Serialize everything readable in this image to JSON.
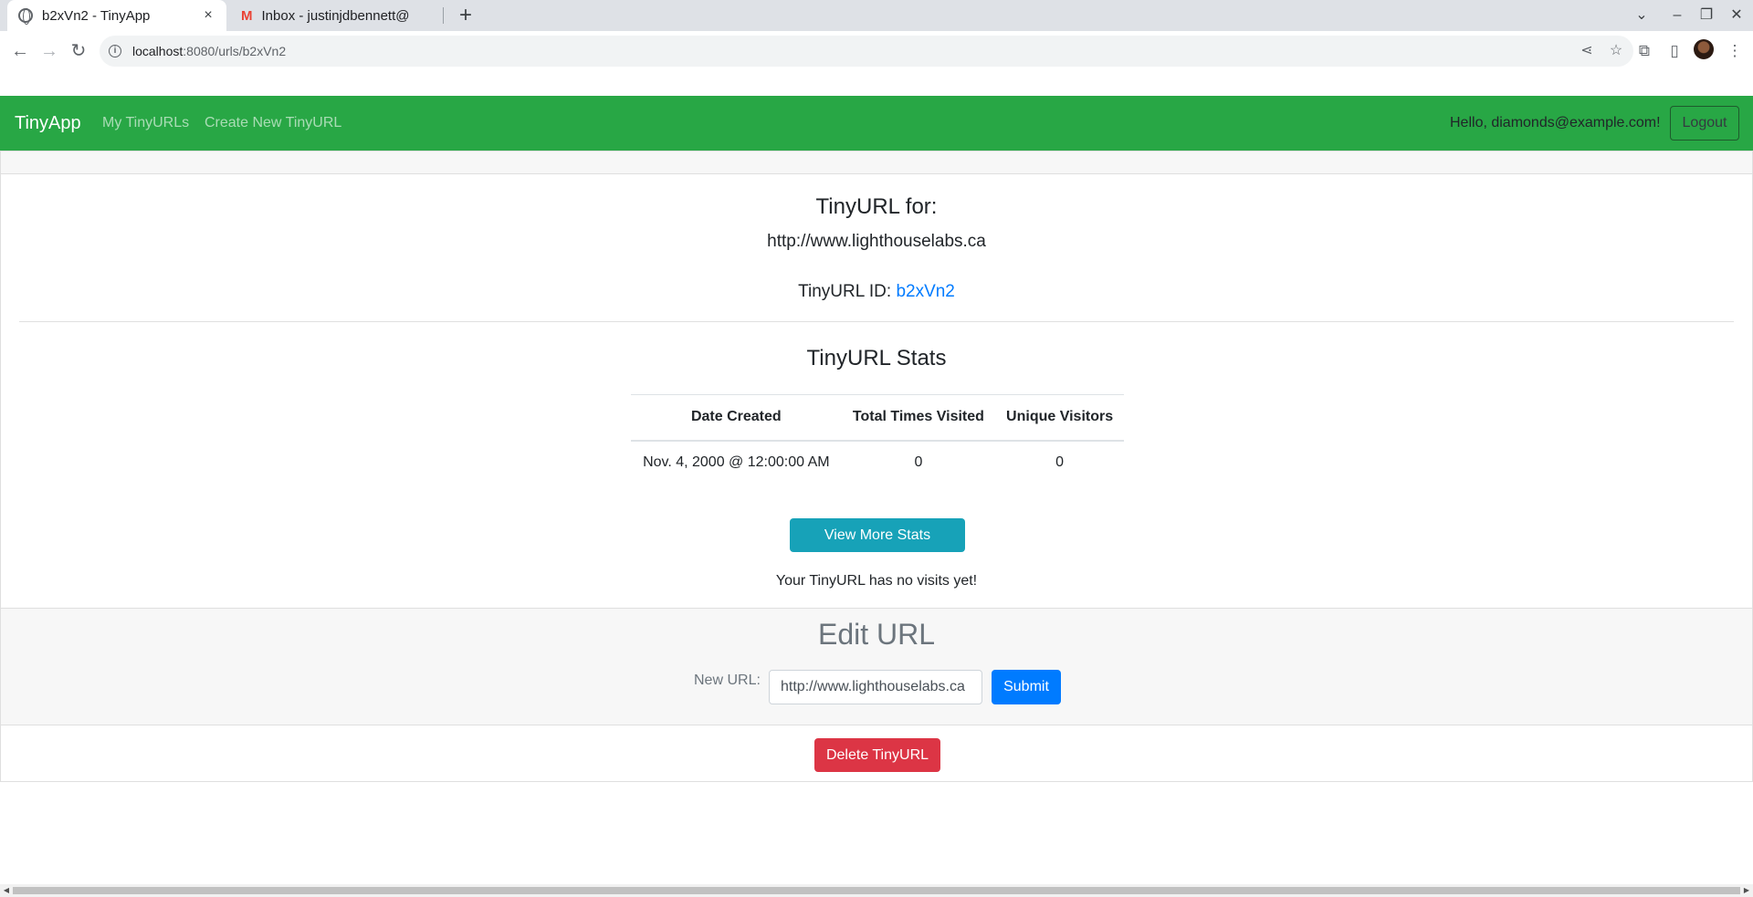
{
  "browser": {
    "tabs": [
      {
        "title": "b2xVn2 - TinyApp",
        "icon": "globe-icon",
        "active": true
      },
      {
        "title": "Inbox - justinjdbennett@",
        "icon": "gmail-icon",
        "active": false
      }
    ],
    "close_glyph": "×",
    "new_tab_glyph": "+",
    "url_host": "localhost",
    "url_rest": ":8080/urls/b2xVn2",
    "window_controls": [
      "⌄",
      "–",
      "❐",
      "✕"
    ]
  },
  "navbar": {
    "brand": "TinyApp",
    "links": [
      "My TinyURLs",
      "Create New TinyURL"
    ],
    "greeting": "Hello, diamonds@example.com!",
    "logout_label": "Logout",
    "background": "#28a745"
  },
  "main": {
    "heading": "TinyURL for:",
    "long_url": "http://www.lighthouselabs.ca",
    "id_label": "TinyURL ID:",
    "id_value": "b2xVn2",
    "stats_heading": "TinyURL Stats",
    "stats_table": {
      "headers": [
        "Date Created",
        "Total Times Visited",
        "Unique Visitors"
      ],
      "rows": [
        [
          "Nov. 4, 2000 @ 12:00:00 AM",
          "0",
          "0"
        ]
      ]
    },
    "more_stats_label": "View More Stats",
    "no_visits_text": "Your TinyURL has no visits yet!"
  },
  "edit": {
    "heading": "Edit URL",
    "field_label": "New URL:",
    "field_value": "http://www.lighthouselabs.ca",
    "submit_label": "Submit"
  },
  "delete_label": "Delete TinyURL",
  "colors": {
    "info_button": "#17a2b8",
    "primary_button": "#007bff",
    "danger_button": "#dc3545",
    "link": "#007bff"
  }
}
